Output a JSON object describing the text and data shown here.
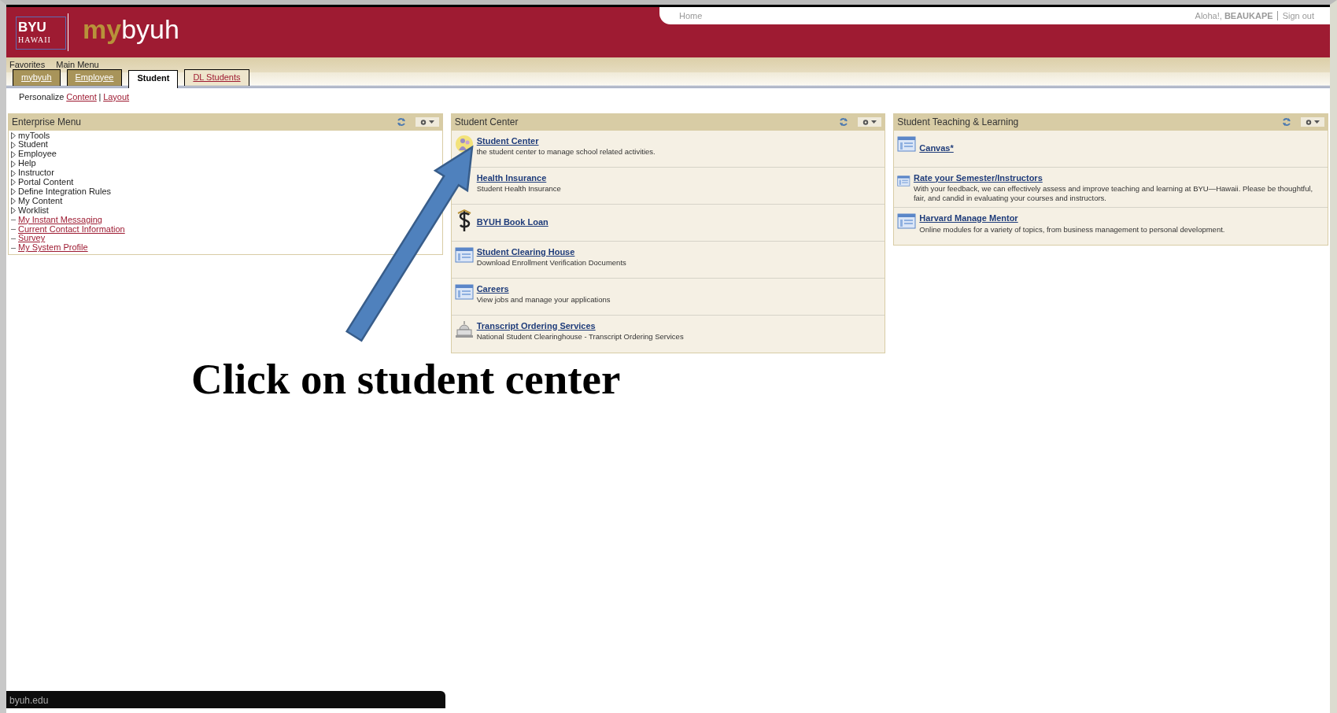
{
  "header": {
    "logo_top": "BYU",
    "logo_bottom": "HAWAII",
    "brand_prefix": "my",
    "brand_suffix": "byuh",
    "home_link": "Home",
    "greeting": "Aloha!,",
    "username": "BEAUKAPE",
    "sign_out": "Sign out"
  },
  "menu_bar": [
    "Favorites",
    "Main Menu"
  ],
  "tabs": [
    {
      "label": "mybyuh",
      "selected": false,
      "kind": "faded"
    },
    {
      "label": "Employee",
      "selected": false,
      "kind": "faded"
    },
    {
      "label": "Student",
      "selected": true,
      "kind": "plain"
    },
    {
      "label": "DL Students",
      "selected": false,
      "kind": "link"
    }
  ],
  "personalize": {
    "label": "Personalize",
    "links": [
      "Content",
      "Layout"
    ],
    "separator": "|"
  },
  "panels": [
    {
      "title": "Enterprise Menu",
      "kind": "menu",
      "items": [
        {
          "label": "myTools",
          "kind": "folder"
        },
        {
          "label": "Student",
          "kind": "folder"
        },
        {
          "label": "Employee",
          "kind": "folder"
        },
        {
          "label": "Help",
          "kind": "folder"
        },
        {
          "label": "Instructor",
          "kind": "folder"
        },
        {
          "label": "Portal Content",
          "kind": "folder"
        },
        {
          "label": "Define Integration Rules",
          "kind": "folder"
        },
        {
          "label": "My Content",
          "kind": "folder"
        },
        {
          "label": "Worklist",
          "kind": "folder"
        },
        {
          "label": "My Instant Messaging",
          "kind": "link"
        },
        {
          "label": "Current Contact Information",
          "kind": "link"
        },
        {
          "label": "Survey",
          "kind": "link"
        },
        {
          "label": "My System Profile",
          "kind": "link"
        }
      ]
    },
    {
      "title": "Student Center",
      "kind": "links",
      "items": [
        {
          "title": "Student Center",
          "description": "the student center to manage school related activities.",
          "kind": "people"
        },
        {
          "title": "Health Insurance",
          "description": "Student Health Insurance"
        },
        {
          "title": "BYUH Book Loan",
          "kind": "dollar"
        },
        {
          "title": "Student Clearing House",
          "description": "Download Enrollment Verification Documents",
          "kind": "page"
        },
        {
          "title": "Careers",
          "description": "View jobs and manage your applications",
          "kind": "page"
        },
        {
          "title": "Transcript Ordering Services",
          "description": "National Student Clearinghouse - Transcript Ordering Services",
          "kind": "capitol"
        }
      ]
    },
    {
      "title": "Student Teaching & Learning",
      "kind": "links",
      "items": [
        {
          "title": "Canvas*",
          "kind": "page"
        },
        {
          "title": "Rate your Semester/Instructors",
          "description": "With your feedback, we can effectively assess and improve teaching and learning at BYU—Hawaii. Please be thoughtful, fair, and candid in evaluating your courses and instructors.",
          "kind": "page"
        },
        {
          "title": "Harvard Manage Mentor",
          "description": "Online modules for a variety of topics, from business management to personal development.",
          "kind": "page"
        }
      ]
    }
  ],
  "annotation": "Click on student center",
  "status_url": "byuh.edu"
}
